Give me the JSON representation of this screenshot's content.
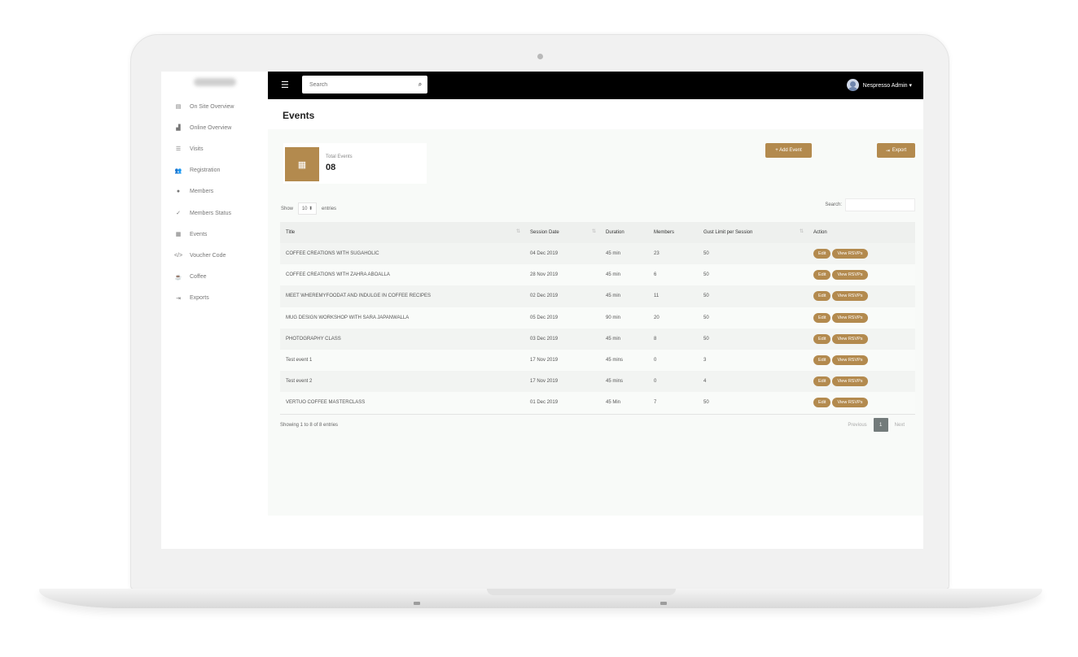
{
  "topbar": {
    "menu_icon": "hamburger-icon",
    "search_placeholder": "Search",
    "user_name": "Nespresso Admin ▾"
  },
  "sidebar": {
    "items": [
      {
        "label": "On Site Overview",
        "icon": "store-icon"
      },
      {
        "label": "Online Overview",
        "icon": "chart-icon"
      },
      {
        "label": "Visits",
        "icon": "list-icon"
      },
      {
        "label": "Registration",
        "icon": "users-icon"
      },
      {
        "label": "Members",
        "icon": "user-icon"
      },
      {
        "label": "Members Status",
        "icon": "user-check-icon"
      },
      {
        "label": "Events",
        "icon": "table-icon"
      },
      {
        "label": "Voucher Code",
        "icon": "code-icon"
      },
      {
        "label": "Coffee",
        "icon": "coffee-icon"
      },
      {
        "label": "Exports",
        "icon": "export-icon"
      }
    ]
  },
  "page": {
    "title": "Events",
    "stat_label": "Total Events",
    "stat_value": "08",
    "add_event_label": "+ Add Event",
    "export_label": "Export",
    "show_label": "Show",
    "length_value": "10 ⬍",
    "entries_label": "entries",
    "search_label": "Search:"
  },
  "table": {
    "headers": [
      "Title",
      "Session Date",
      "Duration",
      "Members",
      "Gust Limit per Session",
      "Action"
    ],
    "rows": [
      [
        "COFFEE CREATIONS WITH SUGAHOLIC",
        "04 Dec 2019",
        "45 min",
        "23",
        "50"
      ],
      [
        "COFFEE CREATIONS WITH ZAHRA ABOALLA",
        "28 Nov 2019",
        "45 min",
        "6",
        "50"
      ],
      [
        "MEET WHEREMYFOODAT AND INDULGE IN COFFEE RECIPES",
        "02 Dec 2019",
        "45 min",
        "11",
        "50"
      ],
      [
        "MUG DESIGN WORKSHOP WITH SARA JAPANWALLA",
        "05 Dec 2019",
        "90 min",
        "20",
        "50"
      ],
      [
        "PHOTOGRAPHY CLASS",
        "03 Dec 2019",
        "45 min",
        "8",
        "50"
      ],
      [
        "Test event 1",
        "17 Nov 2019",
        "45 mins",
        "0",
        "3"
      ],
      [
        "Test event 2",
        "17 Nov 2019",
        "45 mins",
        "0",
        "4"
      ],
      [
        "VERTUO COFFEE MASTERCLASS",
        "01 Dec 2019",
        "45 Min",
        "7",
        "50"
      ]
    ],
    "edit_label": "Edit",
    "rsvp_label": "View RSVPs"
  },
  "footer": {
    "info": "Showing 1 to 8 of 8 entries",
    "previous": "Previous",
    "current_page": "1",
    "next": "Next"
  },
  "colors": {
    "accent": "#b38a4e",
    "topbar": "#000000"
  }
}
